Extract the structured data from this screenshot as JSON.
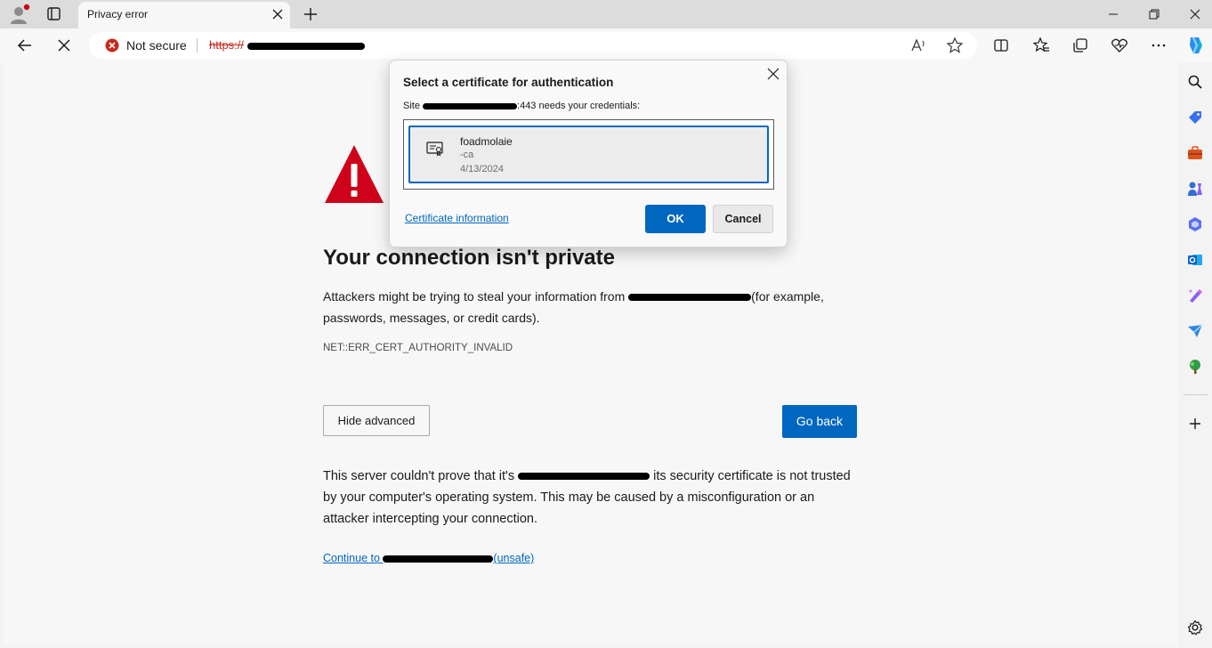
{
  "browser": {
    "tab": {
      "title": "Privacy error"
    },
    "address_bar": {
      "security_label": "Not secure",
      "url_prefix": "https://"
    }
  },
  "page": {
    "heading": "Your connection isn't private",
    "para1_before": "Attackers might be trying to steal your information from ",
    "para1_after": "(for example, passwords, messages, or credit cards).",
    "error_code": "NET::ERR_CERT_AUTHORITY_INVALID",
    "hide_advanced_label": "Hide advanced",
    "go_back_label": "Go back",
    "para2_before": "This server couldn't prove that it's ",
    "para2_after": " its security certificate is not trusted by your computer's operating system. This may be caused by a misconfiguration or an attacker intercepting your connection.",
    "continue_prefix": "Continue to ",
    "continue_suffix": "(unsafe)"
  },
  "dialog": {
    "title": "Select a certificate for authentication",
    "site_prefix": "Site ",
    "site_suffix": ":443 needs your credentials:",
    "certificate": {
      "name": "foadmolaie",
      "issuer": "-ca",
      "date": "4/13/2024"
    },
    "cert_info_link": "Certificate information",
    "ok_label": "OK",
    "cancel_label": "Cancel"
  },
  "colors": {
    "accent": "#0067c0",
    "danger": "#c42b1c",
    "warning_triangle": "#d0021b"
  },
  "icons": [
    "profile-icon",
    "tab-actions-icon",
    "tab-close-icon",
    "new-tab-icon",
    "minimize-icon",
    "restore-icon",
    "window-close-icon",
    "back-icon",
    "stop-loading-icon",
    "not-secure-icon",
    "read-aloud-icon",
    "favorite-star-icon",
    "split-screen-icon",
    "favorites-icon",
    "collections-icon",
    "browser-essentials-icon",
    "more-icon",
    "copilot-icon",
    "warning-icon",
    "certificate-icon",
    "dialog-close-icon",
    "search-icon",
    "shopping-icon",
    "tools-icon",
    "games-icon",
    "microsoft365-icon",
    "outlook-icon",
    "designer-icon",
    "drop-icon",
    "tree-icon",
    "add-icon",
    "settings-icon"
  ]
}
